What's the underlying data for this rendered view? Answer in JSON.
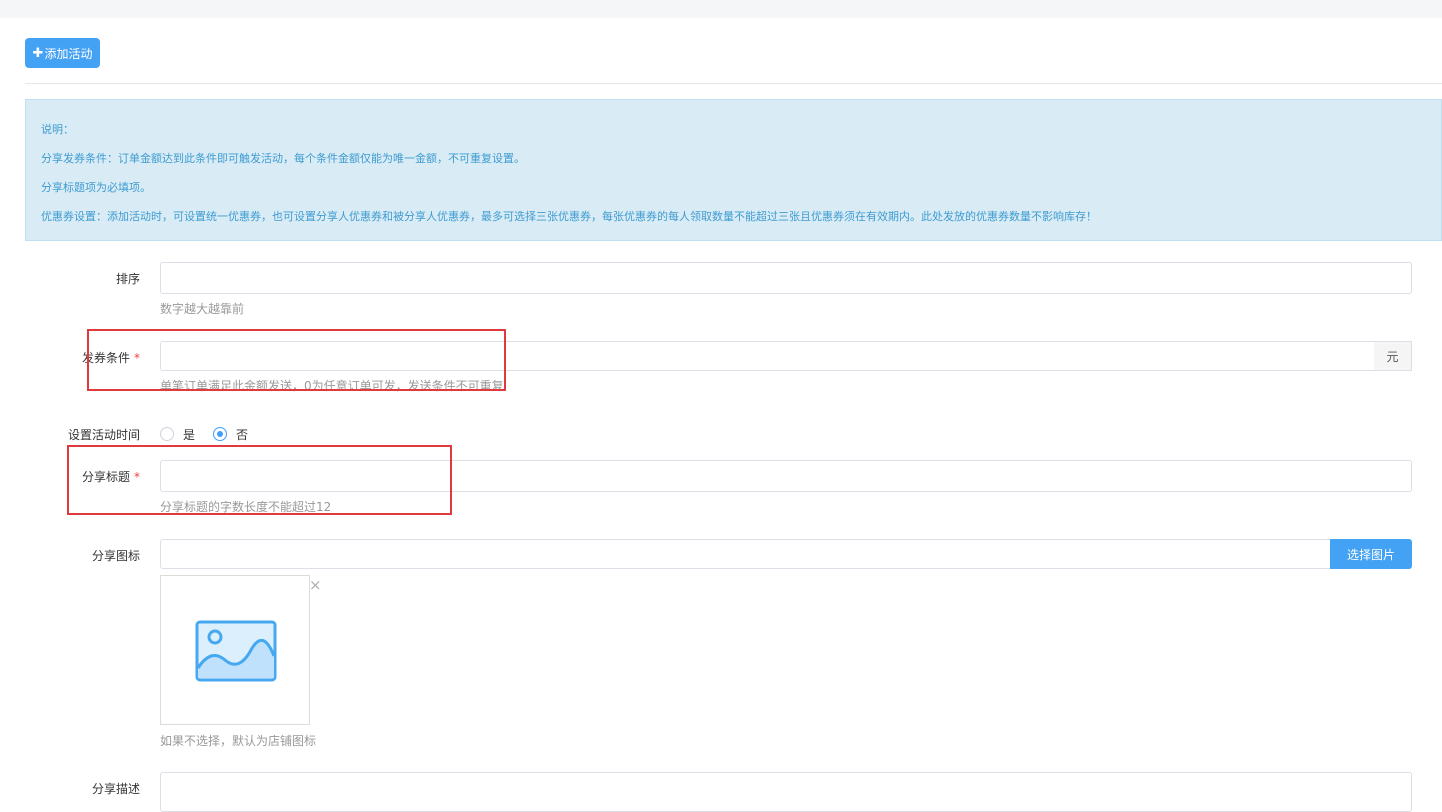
{
  "toolbar": {
    "add_button_label": "添加活动"
  },
  "notice": {
    "lines": [
      "说明：",
      "分享发券条件：订单金额达到此条件即可触发活动，每个条件金额仅能为唯一金额，不可重复设置。",
      "分享标题项为必填项。",
      "优惠券设置：添加活动时，可设置统一优惠券，也可设置分享人优惠券和被分享人优惠券，最多可选择三张优惠券，每张优惠券的每人领取数量不能超过三张且优惠券须在有效期内。此处发放的优惠券数量不影响库存！"
    ]
  },
  "form": {
    "sort": {
      "label": "排序",
      "value": "",
      "hint": "数字越大越靠前"
    },
    "condition": {
      "label": "发券条件",
      "required_mark": "*",
      "value": "",
      "suffix": "元",
      "hint": "单笔订单满足此金额发送，0为任意订单可发，发送条件不可重复"
    },
    "time": {
      "label": "设置活动时间",
      "options": [
        "是",
        "否"
      ],
      "selected": "否"
    },
    "title": {
      "label": "分享标题",
      "required_mark": "*",
      "value": "",
      "hint": "分享标题的字数长度不能超过12"
    },
    "icon": {
      "label": "分享图标",
      "value": "",
      "button_label": "选择图片",
      "close_glyph": "×",
      "preview_icon": "image-placeholder-icon",
      "hint": "如果不选择，默认为店铺图标"
    },
    "desc": {
      "label": "分享描述",
      "value": ""
    }
  },
  "colors": {
    "primary": "#44a2f4",
    "notice_bg": "#d9ecf6",
    "notice_text": "#3f9bd0",
    "highlight": "#e0393e",
    "required": "#e64340"
  }
}
